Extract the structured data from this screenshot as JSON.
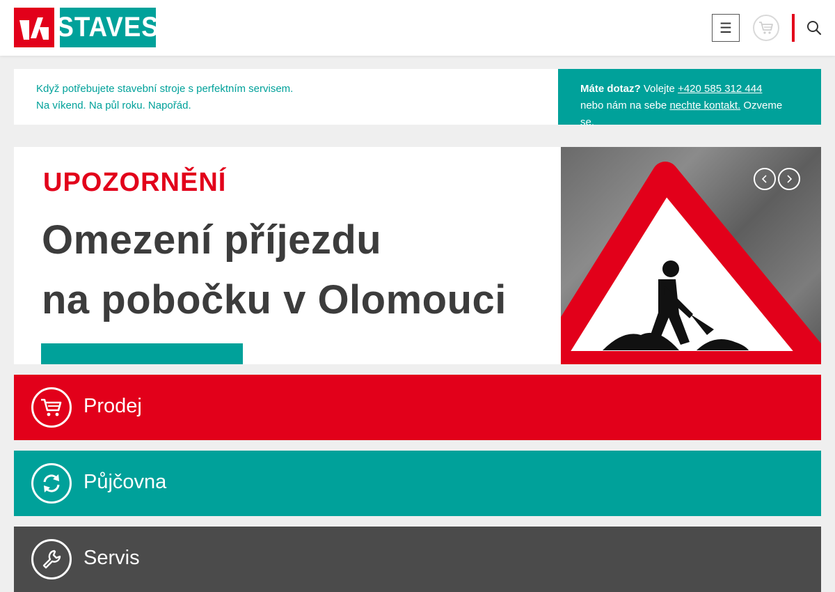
{
  "header": {
    "logo_text": "STAVES",
    "menu_icon": "hamburger-icon",
    "cart_icon": "cart-icon",
    "search_icon": "search-icon"
  },
  "info": {
    "line1": "Když potřebujete stavební stroje s perfektním servisem.",
    "line2": "Na víkend. Na půl roku. Napořád.",
    "question": "Máte dotaz?",
    "call": "Volejte",
    "phone": "+420 585 312 444",
    "or": "nebo nám na sebe",
    "contact_link": "nechte kontakt.",
    "callback": "Ozveme se."
  },
  "banner": {
    "kicker": "UPOZORNĚNÍ",
    "line1": "Omezení příjezdu",
    "line2": "na pobočku v Olomouci",
    "prev_icon": "chevron-left-icon",
    "next_icon": "chevron-right-icon"
  },
  "sections": {
    "prodej": "Prodej",
    "pujcovna": "Půjčovna",
    "servis": "Servis"
  },
  "colors": {
    "red": "#e2001a",
    "teal": "#00a19a",
    "dark": "#4b4b4b"
  }
}
